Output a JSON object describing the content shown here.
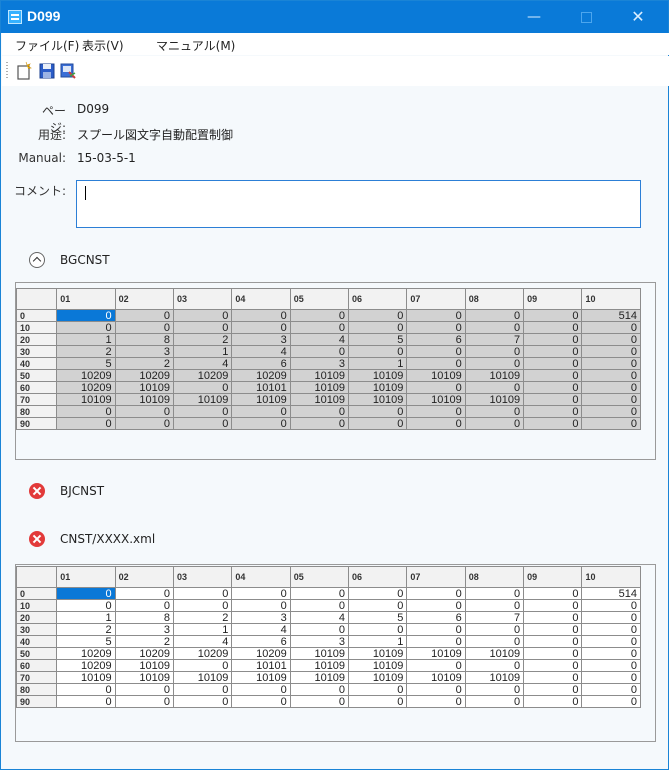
{
  "window": {
    "title": "D099"
  },
  "menu": {
    "items": [
      "ファイル(F)",
      "表示(V)",
      "マニュアル(M)"
    ]
  },
  "toolbar": {
    "icons": [
      "new-page-icon",
      "save-icon",
      "print-icon"
    ]
  },
  "info": {
    "page_label": "ページ:",
    "page_value": "D099",
    "purpose_label": "用途:",
    "purpose_value": "スプール図文字自動配置制御",
    "manual_label": "Manual:",
    "manual_value": "15-03-5-1",
    "comment_label": "コメント:",
    "comment_value": ""
  },
  "sections": {
    "bgcnst": {
      "label": "BGCNST",
      "icon": "collapse-chevron-icon"
    },
    "bjcnst": {
      "label": "BJCNST",
      "icon": "error-icon"
    },
    "cnst": {
      "label": "CNST/XXXX.xml",
      "icon": "error-icon"
    }
  },
  "grid_columns": [
    "01",
    "02",
    "03",
    "04",
    "05",
    "06",
    "07",
    "08",
    "09",
    "10"
  ],
  "grid_rows": [
    {
      "label": "0",
      "cells": [
        "0",
        "0",
        "0",
        "0",
        "0",
        "0",
        "0",
        "0",
        "0",
        "514"
      ]
    },
    {
      "label": "10",
      "cells": [
        "0",
        "0",
        "0",
        "0",
        "0",
        "0",
        "0",
        "0",
        "0",
        "0"
      ]
    },
    {
      "label": "20",
      "cells": [
        "1",
        "8",
        "2",
        "3",
        "4",
        "5",
        "6",
        "7",
        "0",
        "0"
      ]
    },
    {
      "label": "30",
      "cells": [
        "2",
        "3",
        "1",
        "4",
        "0",
        "0",
        "0",
        "0",
        "0",
        "0"
      ]
    },
    {
      "label": "40",
      "cells": [
        "5",
        "2",
        "4",
        "6",
        "3",
        "1",
        "0",
        "0",
        "0",
        "0"
      ]
    },
    {
      "label": "50",
      "cells": [
        "10209",
        "10209",
        "10209",
        "10209",
        "10109",
        "10109",
        "10109",
        "10109",
        "0",
        "0"
      ]
    },
    {
      "label": "60",
      "cells": [
        "10209",
        "10109",
        "0",
        "10101",
        "10109",
        "10109",
        "0",
        "0",
        "0",
        "0"
      ]
    },
    {
      "label": "70",
      "cells": [
        "10109",
        "10109",
        "10109",
        "10109",
        "10109",
        "10109",
        "10109",
        "10109",
        "0",
        "0"
      ]
    },
    {
      "label": "80",
      "cells": [
        "0",
        "0",
        "0",
        "0",
        "0",
        "0",
        "0",
        "0",
        "0",
        "0"
      ]
    },
    {
      "label": "90",
      "cells": [
        "0",
        "0",
        "0",
        "0",
        "0",
        "0",
        "0",
        "0",
        "0",
        "0"
      ]
    }
  ],
  "colors": {
    "titlebar": "#0a7ad8",
    "selection": "#0a78d7",
    "grid_gray": "#d2d2d2",
    "error": "#e23a3a"
  }
}
